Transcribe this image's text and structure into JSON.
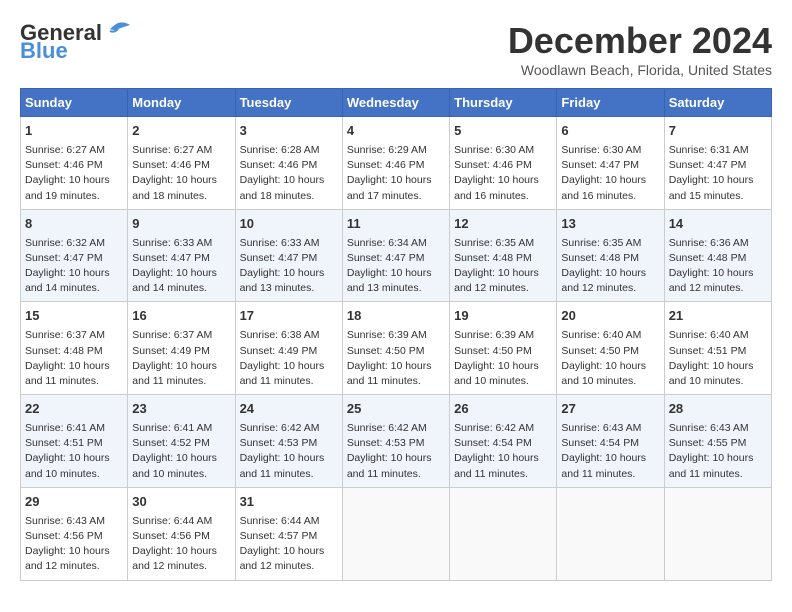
{
  "logo": {
    "line1": "General",
    "line2": "Blue"
  },
  "title": "December 2024",
  "location": "Woodlawn Beach, Florida, United States",
  "days_of_week": [
    "Sunday",
    "Monday",
    "Tuesday",
    "Wednesday",
    "Thursday",
    "Friday",
    "Saturday"
  ],
  "weeks": [
    [
      {
        "day": "1",
        "sunrise": "Sunrise: 6:27 AM",
        "sunset": "Sunset: 4:46 PM",
        "daylight": "Daylight: 10 hours and 19 minutes."
      },
      {
        "day": "2",
        "sunrise": "Sunrise: 6:27 AM",
        "sunset": "Sunset: 4:46 PM",
        "daylight": "Daylight: 10 hours and 18 minutes."
      },
      {
        "day": "3",
        "sunrise": "Sunrise: 6:28 AM",
        "sunset": "Sunset: 4:46 PM",
        "daylight": "Daylight: 10 hours and 18 minutes."
      },
      {
        "day": "4",
        "sunrise": "Sunrise: 6:29 AM",
        "sunset": "Sunset: 4:46 PM",
        "daylight": "Daylight: 10 hours and 17 minutes."
      },
      {
        "day": "5",
        "sunrise": "Sunrise: 6:30 AM",
        "sunset": "Sunset: 4:46 PM",
        "daylight": "Daylight: 10 hours and 16 minutes."
      },
      {
        "day": "6",
        "sunrise": "Sunrise: 6:30 AM",
        "sunset": "Sunset: 4:47 PM",
        "daylight": "Daylight: 10 hours and 16 minutes."
      },
      {
        "day": "7",
        "sunrise": "Sunrise: 6:31 AM",
        "sunset": "Sunset: 4:47 PM",
        "daylight": "Daylight: 10 hours and 15 minutes."
      }
    ],
    [
      {
        "day": "8",
        "sunrise": "Sunrise: 6:32 AM",
        "sunset": "Sunset: 4:47 PM",
        "daylight": "Daylight: 10 hours and 14 minutes."
      },
      {
        "day": "9",
        "sunrise": "Sunrise: 6:33 AM",
        "sunset": "Sunset: 4:47 PM",
        "daylight": "Daylight: 10 hours and 14 minutes."
      },
      {
        "day": "10",
        "sunrise": "Sunrise: 6:33 AM",
        "sunset": "Sunset: 4:47 PM",
        "daylight": "Daylight: 10 hours and 13 minutes."
      },
      {
        "day": "11",
        "sunrise": "Sunrise: 6:34 AM",
        "sunset": "Sunset: 4:47 PM",
        "daylight": "Daylight: 10 hours and 13 minutes."
      },
      {
        "day": "12",
        "sunrise": "Sunrise: 6:35 AM",
        "sunset": "Sunset: 4:48 PM",
        "daylight": "Daylight: 10 hours and 12 minutes."
      },
      {
        "day": "13",
        "sunrise": "Sunrise: 6:35 AM",
        "sunset": "Sunset: 4:48 PM",
        "daylight": "Daylight: 10 hours and 12 minutes."
      },
      {
        "day": "14",
        "sunrise": "Sunrise: 6:36 AM",
        "sunset": "Sunset: 4:48 PM",
        "daylight": "Daylight: 10 hours and 12 minutes."
      }
    ],
    [
      {
        "day": "15",
        "sunrise": "Sunrise: 6:37 AM",
        "sunset": "Sunset: 4:48 PM",
        "daylight": "Daylight: 10 hours and 11 minutes."
      },
      {
        "day": "16",
        "sunrise": "Sunrise: 6:37 AM",
        "sunset": "Sunset: 4:49 PM",
        "daylight": "Daylight: 10 hours and 11 minutes."
      },
      {
        "day": "17",
        "sunrise": "Sunrise: 6:38 AM",
        "sunset": "Sunset: 4:49 PM",
        "daylight": "Daylight: 10 hours and 11 minutes."
      },
      {
        "day": "18",
        "sunrise": "Sunrise: 6:39 AM",
        "sunset": "Sunset: 4:50 PM",
        "daylight": "Daylight: 10 hours and 11 minutes."
      },
      {
        "day": "19",
        "sunrise": "Sunrise: 6:39 AM",
        "sunset": "Sunset: 4:50 PM",
        "daylight": "Daylight: 10 hours and 10 minutes."
      },
      {
        "day": "20",
        "sunrise": "Sunrise: 6:40 AM",
        "sunset": "Sunset: 4:50 PM",
        "daylight": "Daylight: 10 hours and 10 minutes."
      },
      {
        "day": "21",
        "sunrise": "Sunrise: 6:40 AM",
        "sunset": "Sunset: 4:51 PM",
        "daylight": "Daylight: 10 hours and 10 minutes."
      }
    ],
    [
      {
        "day": "22",
        "sunrise": "Sunrise: 6:41 AM",
        "sunset": "Sunset: 4:51 PM",
        "daylight": "Daylight: 10 hours and 10 minutes."
      },
      {
        "day": "23",
        "sunrise": "Sunrise: 6:41 AM",
        "sunset": "Sunset: 4:52 PM",
        "daylight": "Daylight: 10 hours and 10 minutes."
      },
      {
        "day": "24",
        "sunrise": "Sunrise: 6:42 AM",
        "sunset": "Sunset: 4:53 PM",
        "daylight": "Daylight: 10 hours and 11 minutes."
      },
      {
        "day": "25",
        "sunrise": "Sunrise: 6:42 AM",
        "sunset": "Sunset: 4:53 PM",
        "daylight": "Daylight: 10 hours and 11 minutes."
      },
      {
        "day": "26",
        "sunrise": "Sunrise: 6:42 AM",
        "sunset": "Sunset: 4:54 PM",
        "daylight": "Daylight: 10 hours and 11 minutes."
      },
      {
        "day": "27",
        "sunrise": "Sunrise: 6:43 AM",
        "sunset": "Sunset: 4:54 PM",
        "daylight": "Daylight: 10 hours and 11 minutes."
      },
      {
        "day": "28",
        "sunrise": "Sunrise: 6:43 AM",
        "sunset": "Sunset: 4:55 PM",
        "daylight": "Daylight: 10 hours and 11 minutes."
      }
    ],
    [
      {
        "day": "29",
        "sunrise": "Sunrise: 6:43 AM",
        "sunset": "Sunset: 4:56 PM",
        "daylight": "Daylight: 10 hours and 12 minutes."
      },
      {
        "day": "30",
        "sunrise": "Sunrise: 6:44 AM",
        "sunset": "Sunset: 4:56 PM",
        "daylight": "Daylight: 10 hours and 12 minutes."
      },
      {
        "day": "31",
        "sunrise": "Sunrise: 6:44 AM",
        "sunset": "Sunset: 4:57 PM",
        "daylight": "Daylight: 10 hours and 12 minutes."
      },
      null,
      null,
      null,
      null
    ]
  ]
}
